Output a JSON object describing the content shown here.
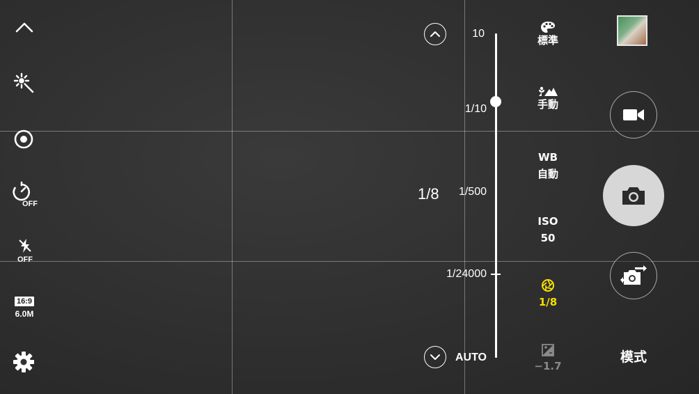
{
  "left_toolbar": {
    "timer_state": "OFF",
    "flash_state": "OFF",
    "aspect_ratio": "16:9",
    "resolution": "6.0M"
  },
  "shutter_slider": {
    "current_value": "1/8",
    "ticks": [
      "10",
      "1/10",
      "1/500",
      "1/24000",
      "AUTO"
    ]
  },
  "settings": {
    "color_tone": "標準",
    "focus": "手動",
    "wb_top": "WB",
    "wb_value": "自動",
    "iso_top": "ISO",
    "iso_value": "50",
    "shutter_value": "1/8",
    "exposure_value": "−1.7"
  },
  "mode_label": "模式",
  "colors": {
    "accent_active": "#f5e000",
    "shutter_button": "#d7d7d7",
    "background": "#323232"
  }
}
